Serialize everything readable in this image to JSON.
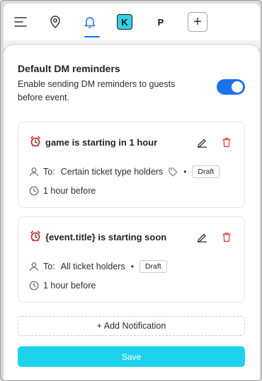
{
  "nav": {
    "items": [
      {
        "name": "menu",
        "icon": "menu-icon"
      },
      {
        "name": "location",
        "icon": "location-pin-icon"
      },
      {
        "name": "notifications",
        "icon": "bell-icon",
        "active": true
      },
      {
        "name": "workspace-k",
        "label": "K"
      },
      {
        "name": "workspace-p",
        "label": "P"
      },
      {
        "name": "add",
        "label": "+"
      }
    ],
    "accent": "#1a73e8"
  },
  "settings": {
    "title": "Default DM reminders",
    "description": "Enable sending DM reminders to guests before event.",
    "enabled": true
  },
  "reminders": [
    {
      "title": "game is starting in 1 hour",
      "to_prefix": "To:",
      "recipients": "Certain ticket type holders",
      "status": "Draft",
      "timing": "1 hour before"
    },
    {
      "title": "{event.title} is starting soon",
      "to_prefix": "To:",
      "recipients": "All ticket holders",
      "status": "Draft",
      "timing": "1 hour before"
    }
  ],
  "actions": {
    "add_label": "+ Add Notification",
    "save_label": "Save"
  },
  "colors": {
    "toggle_on": "#1a73e8",
    "save_button": "#1ed2ee",
    "delete_icon": "#e5484d",
    "workspace_k": "#33d1e6"
  }
}
